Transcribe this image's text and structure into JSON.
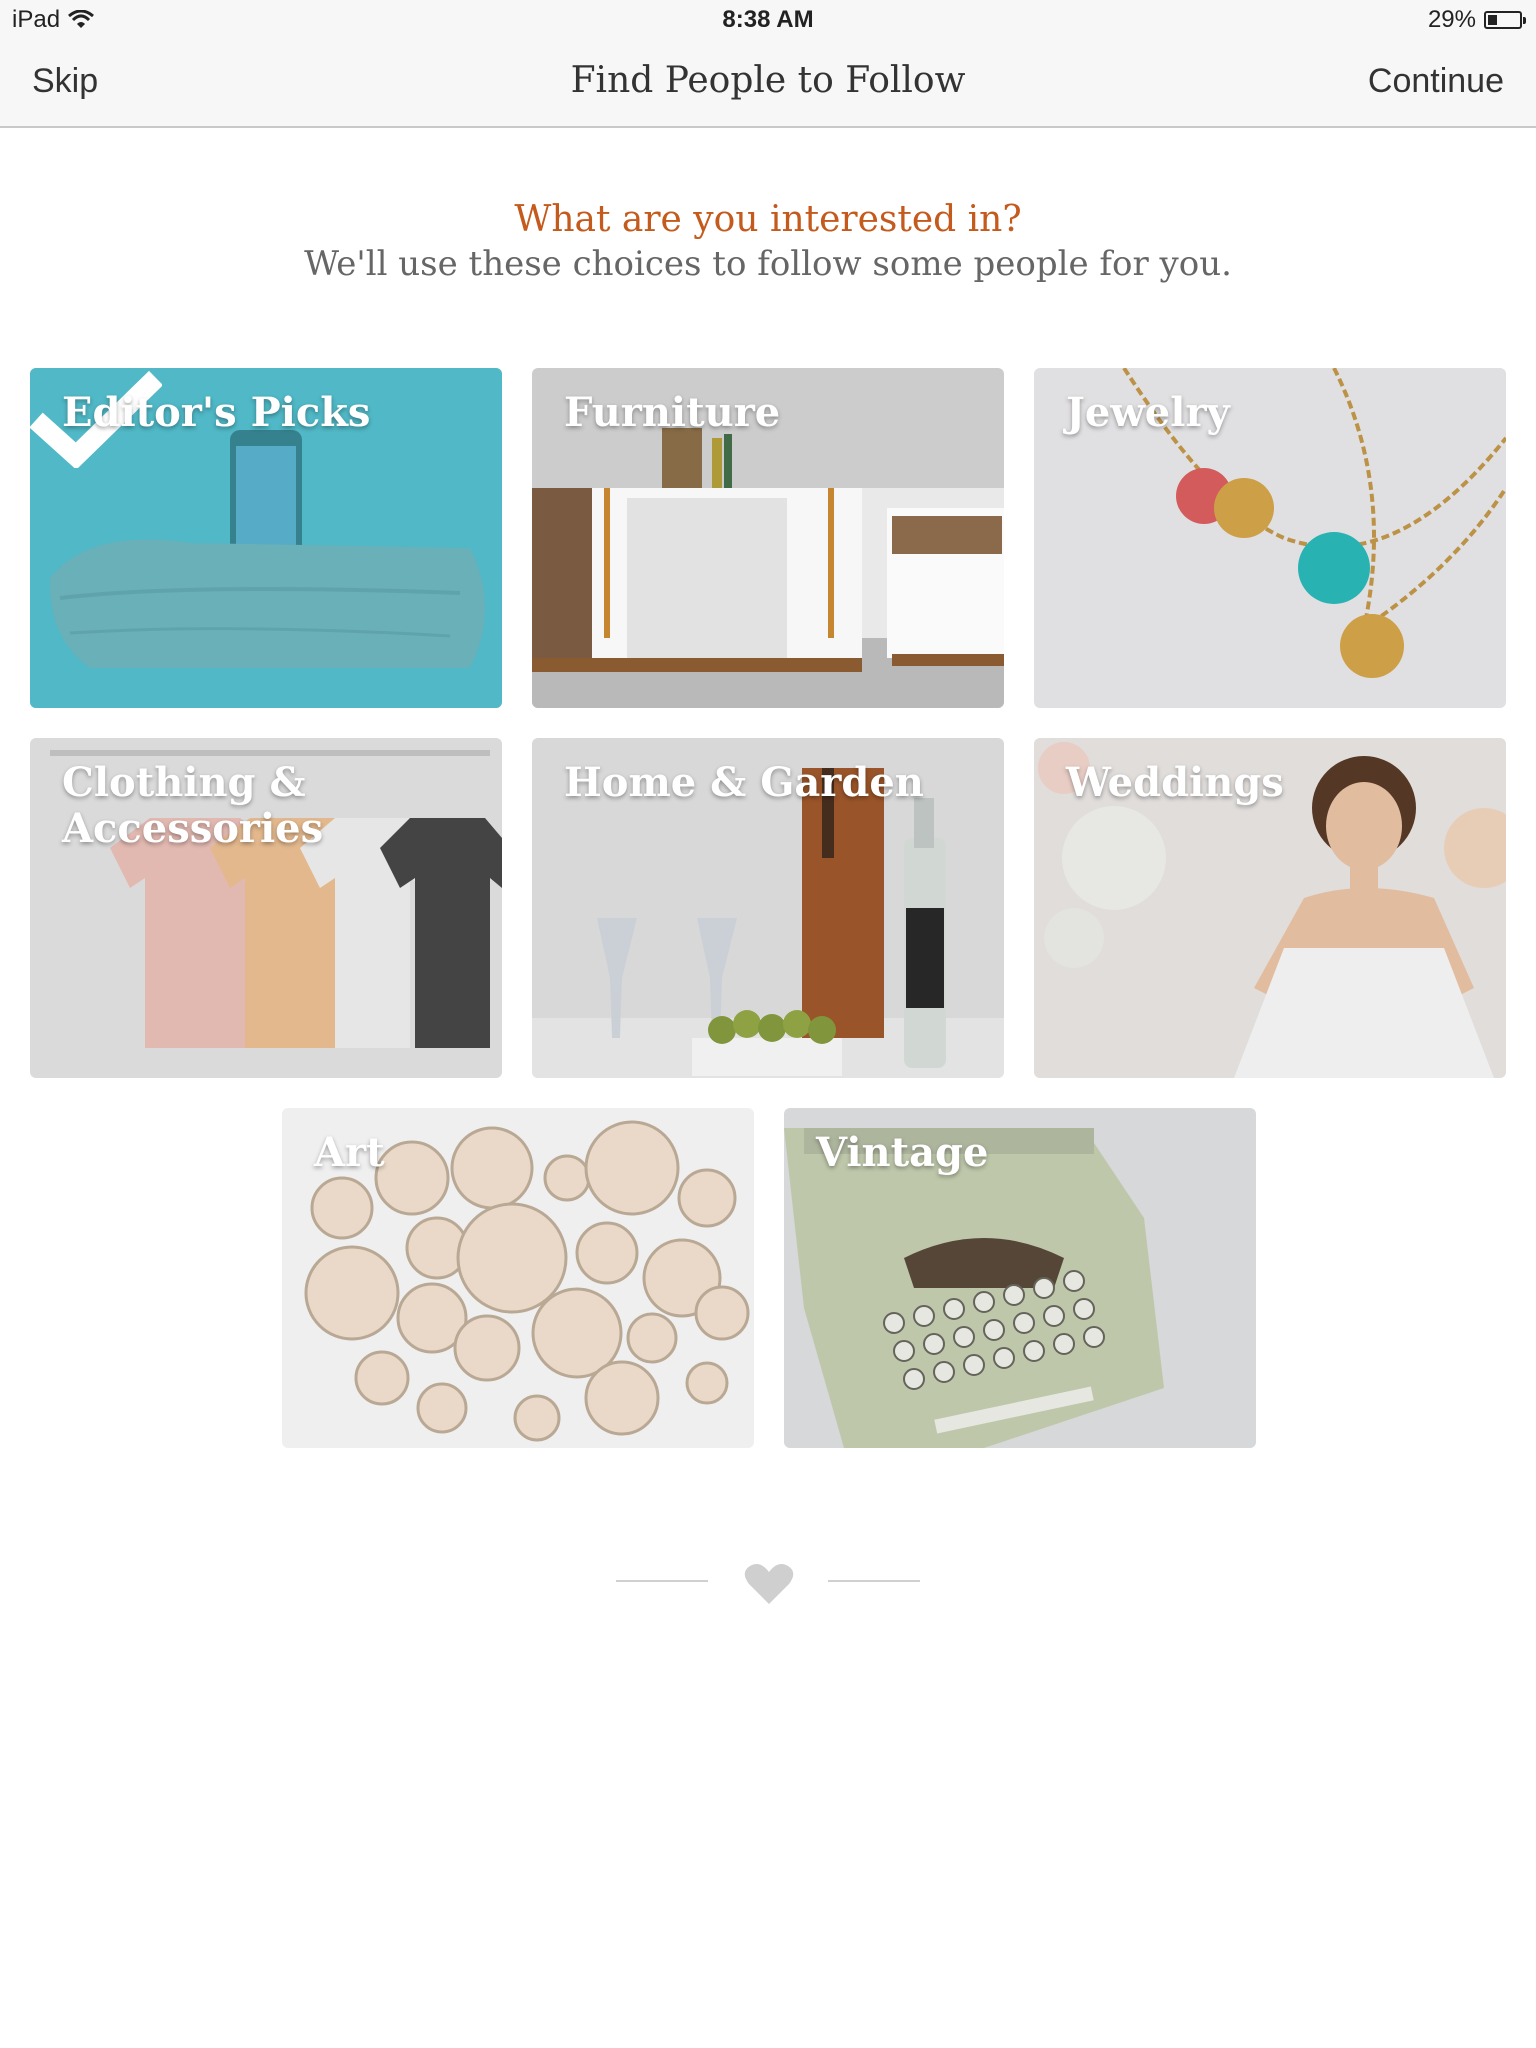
{
  "status_bar": {
    "device": "iPad",
    "time": "8:38 AM",
    "battery": "29%",
    "battery_level": 0.29
  },
  "nav": {
    "skip": "Skip",
    "title": "Find People to Follow",
    "continue": "Continue"
  },
  "intro": {
    "question": "What are you interested in?",
    "subtitle": "We'll use these choices to follow some people for you."
  },
  "categories": [
    {
      "label": "Editor's Picks",
      "selected": true
    },
    {
      "label": "Furniture",
      "selected": false
    },
    {
      "label": "Jewelry",
      "selected": false
    },
    {
      "label": "Clothing & Accessories",
      "selected": false
    },
    {
      "label": "Home & Garden",
      "selected": false
    },
    {
      "label": "Weddings",
      "selected": false
    },
    {
      "label": "Art",
      "selected": false
    },
    {
      "label": "Vintage",
      "selected": false
    }
  ],
  "colors": {
    "accent": "#c45a1c",
    "selected_overlay": "#3fb7c6"
  },
  "icons": {
    "footer": "heart-icon",
    "selected_mark": "checkmark-icon"
  }
}
